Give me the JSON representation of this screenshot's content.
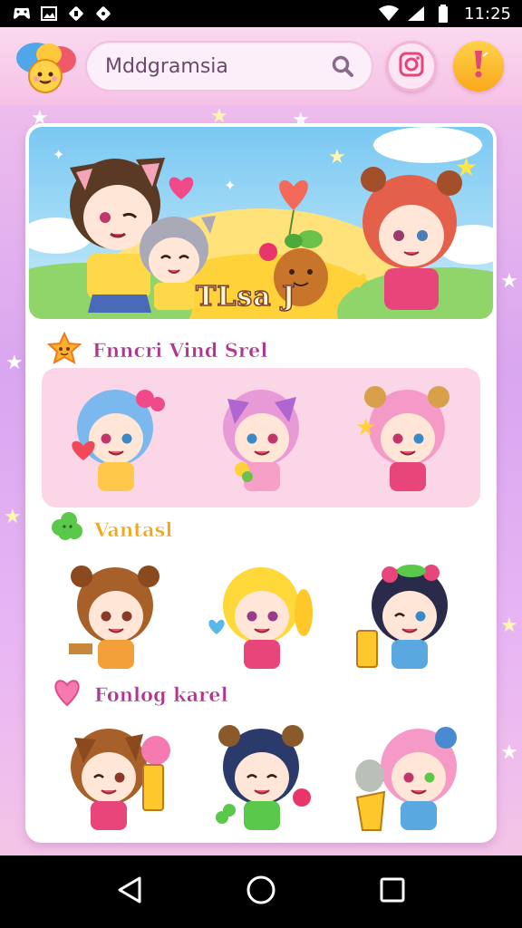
{
  "status_bar": {
    "time": "11:25",
    "left_icons": [
      "game-controller-icon",
      "photo-icon",
      "app-icon",
      "notification-icon"
    ],
    "right_icons": [
      "wifi-icon",
      "signal-icon",
      "battery-icon"
    ]
  },
  "header": {
    "search_value": "Mddgramsia",
    "search_icon": "search-icon",
    "camera_icon": "camera-icon",
    "alert_icon": "exclamation-icon"
  },
  "hero": {
    "title": "TLsa J"
  },
  "sections": [
    {
      "title": "Fnncri Vind Srel",
      "icon": "star-badge-icon",
      "color": "#b0358f"
    },
    {
      "title": "Vantasl",
      "icon": "clover-icon",
      "color": "#f0a81c"
    },
    {
      "title": "Fonlog karel",
      "icon": "heart-icon",
      "color": "#b0358f"
    }
  ],
  "rows": [
    {
      "items": [
        "blue-hair-girl",
        "pink-cat-girl",
        "pink-bear-girl"
      ]
    },
    {
      "items": [
        "brown-bear-girl",
        "blonde-girl",
        "dark-hair-girl"
      ]
    },
    {
      "items": [
        "brown-cat-girl",
        "navy-bear-girl",
        "pink-bow-girl"
      ]
    }
  ],
  "nav": {
    "back_icon": "back-triangle-icon",
    "home_icon": "home-circle-icon",
    "recents_icon": "recents-square-icon"
  },
  "colors": {
    "accent_pink": "#f3b4d6",
    "accent_yellow": "#f9a81b",
    "section_magenta": "#b0358f"
  }
}
